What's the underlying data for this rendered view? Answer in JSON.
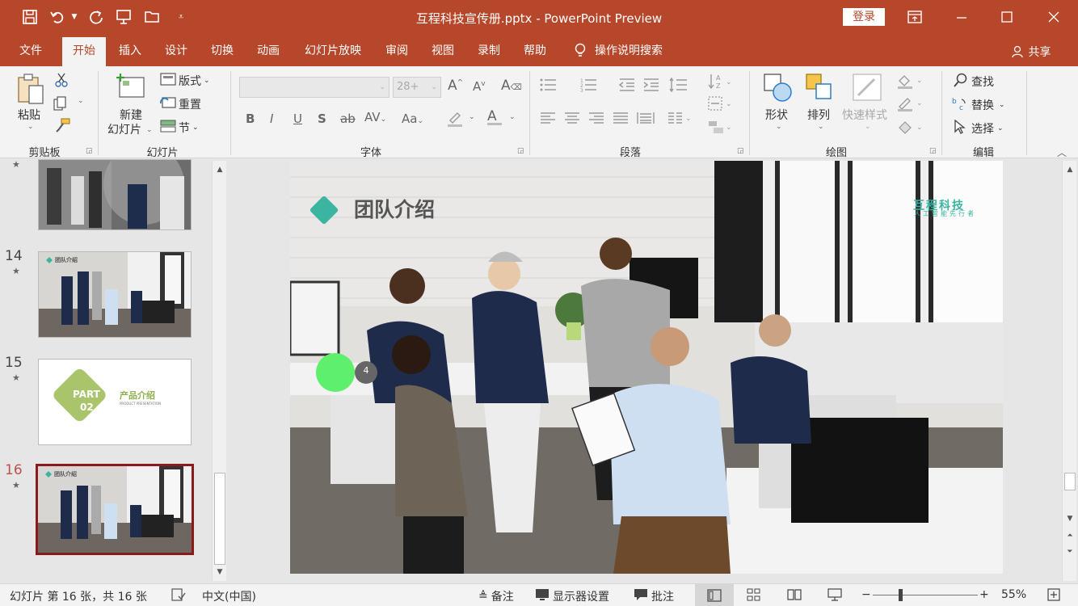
{
  "window": {
    "title": "互程科技宣传册.pptx  -  PowerPoint Preview",
    "login_label": "登录",
    "share_label": "共享"
  },
  "tabs": [
    "文件",
    "开始",
    "插入",
    "设计",
    "切换",
    "动画",
    "幻灯片放映",
    "审阅",
    "视图",
    "录制",
    "帮助"
  ],
  "tell_me": "操作说明搜索",
  "ribbon": {
    "clipboard": {
      "paste": "粘贴",
      "label": "剪贴板"
    },
    "slides": {
      "new_slide_1": "新建",
      "new_slide_2": "幻灯片",
      "layout": "版式",
      "reset": "重置",
      "section": "节",
      "label": "幻灯片"
    },
    "font": {
      "size_placeholder": "28+",
      "label": "字体"
    },
    "paragraph": {
      "label": "段落"
    },
    "drawing": {
      "shapes": "形状",
      "arrange": "排列",
      "quick_styles": "快速样式",
      "label": "绘图"
    },
    "editing": {
      "find": "查找",
      "replace": "替换",
      "select": "选择",
      "label": "编辑"
    }
  },
  "thumbnails": [
    {
      "number": "14",
      "title": "团队介绍",
      "star": "★"
    },
    {
      "number": "15",
      "title": "产品介绍",
      "part": "PART",
      "part_num": "02",
      "subtitle": "PRODUCT PRESENTATION",
      "star": "★"
    },
    {
      "number": "16",
      "title": "团队介绍",
      "star": "★"
    }
  ],
  "slide": {
    "title": "团队介绍",
    "brand": "互程科技",
    "brand_sub": "人工智能先行者",
    "badge_number": "4"
  },
  "status": {
    "slide_info": "幻灯片 第 16 张，共 16 张",
    "language": "中文(中国)",
    "notes": "备注",
    "display_settings": "显示器设置",
    "comments": "批注",
    "zoom": "55%"
  },
  "colors": {
    "accent": "#b7472a",
    "teal": "#3bb5a0",
    "selected_border": "#8b1a1a",
    "green_dot": "#5ef06c"
  }
}
